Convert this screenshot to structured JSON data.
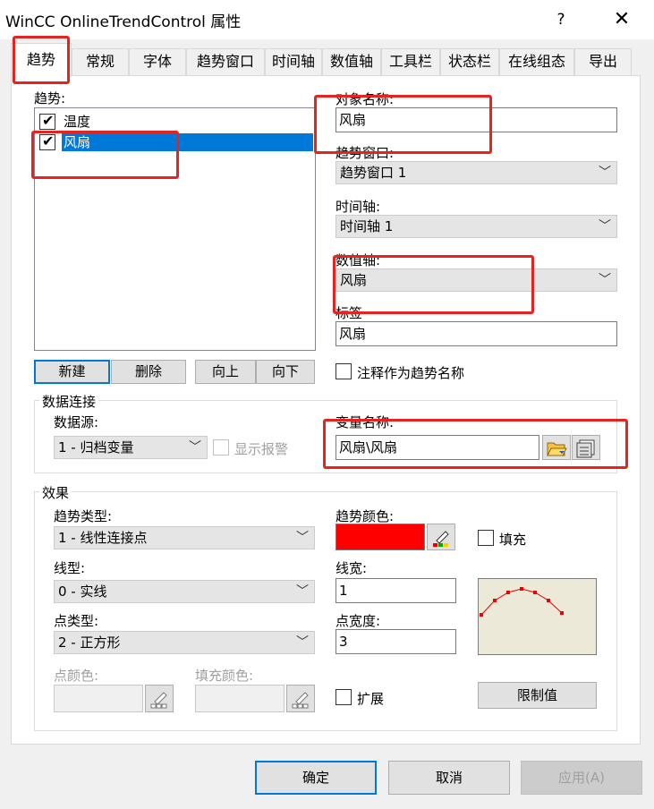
{
  "window": {
    "title": "WinCC OnlineTrendControl 属性",
    "help": "?",
    "close": "✕"
  },
  "tabs": [
    "趋势",
    "常规",
    "字体",
    "趋势窗口",
    "时间轴",
    "数值轴",
    "工具栏",
    "状态栏",
    "在线组态",
    "导出"
  ],
  "active_tab": "趋势",
  "trends": {
    "label": "趋势:",
    "items": [
      {
        "name": "温度",
        "checked": true,
        "selected": false
      },
      {
        "name": "风扇",
        "checked": true,
        "selected": true
      }
    ],
    "buttons": {
      "new": "新建",
      "delete": "删除",
      "up": "向上",
      "down": "向下"
    }
  },
  "object_name": {
    "label": "对象名称:",
    "value": "风扇"
  },
  "trend_window": {
    "label": "趋势窗口:",
    "value": "趋势窗口 1"
  },
  "time_axis": {
    "label": "时间轴:",
    "value": "时间轴 1"
  },
  "value_axis": {
    "label": "数值轴:",
    "value": "风扇"
  },
  "tag_label": {
    "label": "标签",
    "value": "风扇"
  },
  "annotation_as_name": {
    "label": "注释作为趋势名称",
    "checked": false
  },
  "data_connection": {
    "title": "数据连接",
    "source_label": "数据源:",
    "source_value": "1 - 归档变量",
    "show_alarm_label": "显示报警",
    "variable_label": "变量名称:",
    "variable_value": "风扇\\风扇"
  },
  "effects": {
    "title": "效果",
    "trend_type_label": "趋势类型:",
    "trend_type_value": "1 - 线性连接点",
    "trend_color_label": "趋势颜色:",
    "trend_color": "#ff0000",
    "fill_label": "填充",
    "line_type_label": "线型:",
    "line_type_value": "0 - 实线",
    "line_width_label": "线宽:",
    "line_width_value": "1",
    "point_type_label": "点类型:",
    "point_type_value": "2 - 正方形",
    "point_width_label": "点宽度:",
    "point_width_value": "3",
    "point_color_label": "点颜色:",
    "fill_color_label": "填充颜色:",
    "extend_label": "扩展",
    "limit_button": "限制值"
  },
  "footer": {
    "ok": "确定",
    "cancel": "取消",
    "apply": "应用(A)"
  },
  "colors": {
    "accent": "#0078d7",
    "annotation": "#e8231f",
    "preview_bg": "#ece9d8"
  }
}
